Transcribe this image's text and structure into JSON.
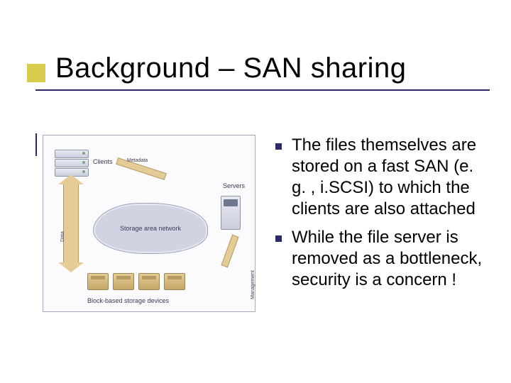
{
  "title": "Background – SAN sharing",
  "bullets": [
    "The files themselves are stored on a fast SAN (e. g. , i.SCSI) to which the clients are also attached",
    "While the file server is removed as a bottleneck, security is a concern !"
  ],
  "diagram": {
    "clients_label": "Clients",
    "servers_label": "Servers",
    "cloud_label": "Storage area network",
    "storage_label": "Block-based storage devices",
    "data_label": "Data",
    "metadata_label": "Metadata",
    "management_label": "Management"
  }
}
